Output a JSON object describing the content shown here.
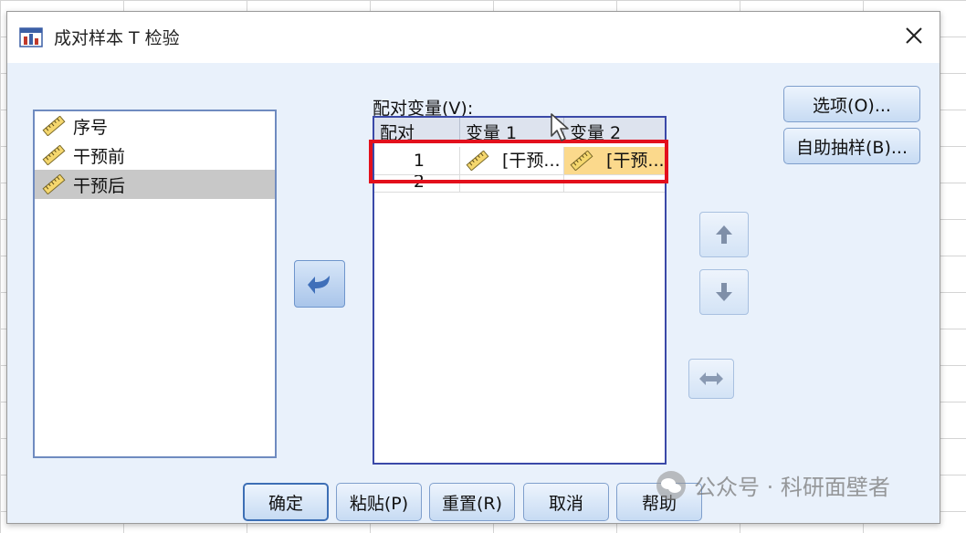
{
  "window": {
    "title": "成对样本 T 检验",
    "close_label": "×"
  },
  "variables": [
    {
      "label": "序号",
      "selected": false
    },
    {
      "label": "干预前",
      "selected": false
    },
    {
      "label": "干预后",
      "selected": true
    }
  ],
  "paired": {
    "label": "配对变量(V):",
    "headers": [
      "配对",
      "变量 1",
      "变量 2"
    ],
    "rows": [
      {
        "num": "1",
        "var1": "[干预...",
        "var2": "[干预..."
      },
      {
        "num": "2",
        "var1": "",
        "var2": ""
      }
    ]
  },
  "side_buttons": {
    "options": "选项(O)...",
    "bootstrap": "自助抽样(B)..."
  },
  "bottom_buttons": {
    "ok": "确定",
    "paste": "粘贴(P)",
    "reset": "重置(R)",
    "cancel": "取消",
    "help": "帮助"
  },
  "watermark": "公众号 · 科研面壁者",
  "colors": {
    "highlight": "#e3101c",
    "accent": "#3a49a8",
    "selected_cell": "#fbd98c",
    "dialog_bg": "#e9f1fb"
  }
}
